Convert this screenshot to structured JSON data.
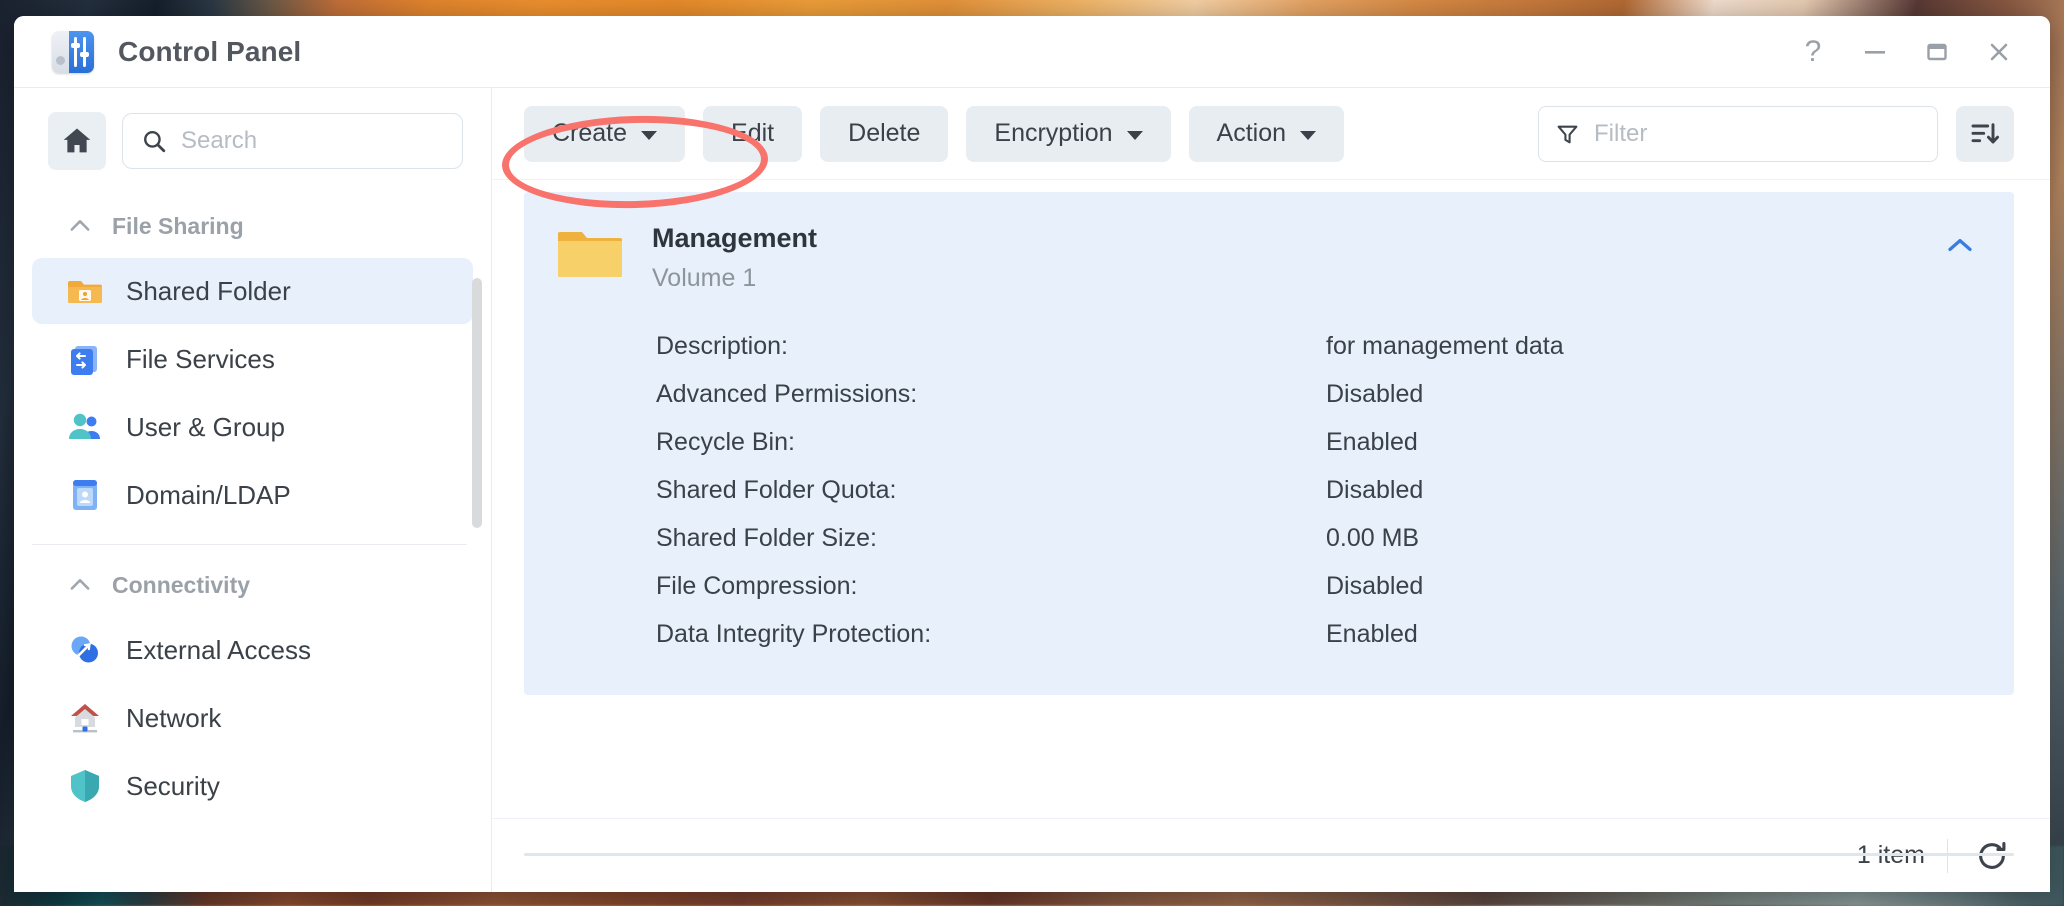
{
  "window": {
    "title": "Control Panel",
    "app_icon": "control-panel-sliders-icon",
    "controls": {
      "help": "?",
      "minimize": "minimize-icon",
      "maximize": "maximize-icon",
      "close": "close-icon"
    }
  },
  "sidebar": {
    "home_icon": "home-icon",
    "search": {
      "value": "",
      "placeholder": "Search"
    },
    "groups": [
      {
        "label": "File Sharing",
        "caret": "chevron-up-icon",
        "items": [
          {
            "label": "Shared Folder",
            "icon": "shared-folder-icon",
            "active": true
          },
          {
            "label": "File Services",
            "icon": "file-services-icon",
            "active": false
          },
          {
            "label": "User & Group",
            "icon": "user-group-icon",
            "active": false
          },
          {
            "label": "Domain/LDAP",
            "icon": "domain-ldap-icon",
            "active": false
          }
        ]
      },
      {
        "label": "Connectivity",
        "caret": "chevron-up-icon",
        "items": [
          {
            "label": "External Access",
            "icon": "external-access-icon",
            "active": false
          },
          {
            "label": "Network",
            "icon": "network-icon",
            "active": false
          },
          {
            "label": "Security",
            "icon": "security-shield-icon",
            "active": false
          }
        ]
      }
    ]
  },
  "toolbar": {
    "buttons": [
      {
        "label": "Create",
        "has_menu": true
      },
      {
        "label": "Edit",
        "has_menu": false
      },
      {
        "label": "Delete",
        "has_menu": false
      },
      {
        "label": "Encryption",
        "has_menu": true
      },
      {
        "label": "Action",
        "has_menu": true
      }
    ],
    "filter": {
      "value": "",
      "placeholder": "Filter",
      "icon": "funnel-icon"
    },
    "sort": {
      "icon": "sort-descending-icon"
    }
  },
  "detail_card": {
    "folder_icon": "folder-icon",
    "name": "Management",
    "location": "Volume 1",
    "collapse_icon": "chevron-up-icon",
    "rows": [
      {
        "label": "Description:",
        "value": "for management data"
      },
      {
        "label": "Advanced Permissions:",
        "value": "Disabled"
      },
      {
        "label": "Recycle Bin:",
        "value": "Enabled"
      },
      {
        "label": "Shared Folder Quota:",
        "value": "Disabled"
      },
      {
        "label": "Shared Folder Size:",
        "value": "0.00 MB"
      },
      {
        "label": "File Compression:",
        "value": "Disabled"
      },
      {
        "label": "Data Integrity Protection:",
        "value": "Enabled"
      }
    ]
  },
  "statusbar": {
    "count": "1 item",
    "refresh_icon": "refresh-icon"
  },
  "annotation": {
    "shape": "ellipse-highlight",
    "color": "#f8736b",
    "target": "Create"
  },
  "colors": {
    "accent": "#3a7ce0",
    "selection_bg": "#e8f0fb",
    "button_bg": "#e8edf2",
    "annotation": "#f8736b"
  }
}
